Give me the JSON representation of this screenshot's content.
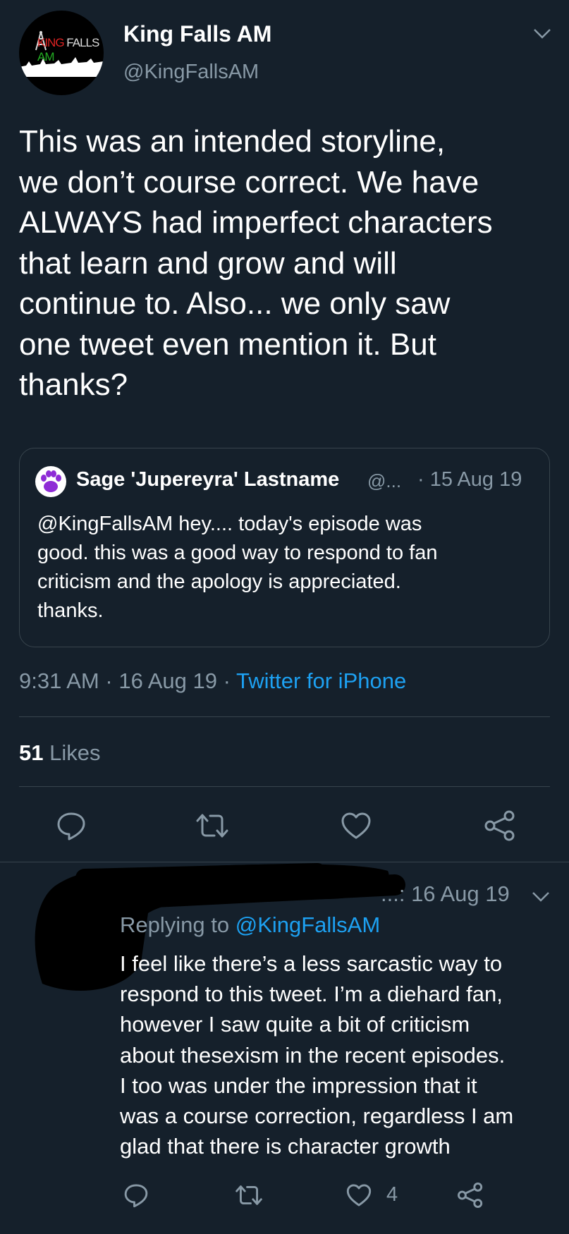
{
  "tweet": {
    "display_name": "King Falls AM",
    "handle": "@KingFallsAM",
    "avatar_logo_text": [
      "KING",
      "FALLS",
      "AM"
    ],
    "body": "This was an intended storyline,\nwe don’t course correct. We have\nALWAYS had imperfect characters\nthat learn and grow and will\ncontinue to. Also... we only saw\none tweet even mention it. But\nthanks?",
    "time": "9:31 AM",
    "date": "16 Aug 19",
    "source": "Twitter for iPhone",
    "likes_count": "51",
    "likes_label": "Likes"
  },
  "quote": {
    "display_name": "Sage 'Jupereyra' Lastname",
    "handle": "@...",
    "date": "· 15 Aug 19",
    "text": "@KingFallsAM hey.... today's episode was\ngood. this was a good way to respond to fan\ncriticism and the apology is appreciated.\nthanks."
  },
  "reply": {
    "date": "...: 16 Aug 19",
    "replying_prefix": "Replying to",
    "replying_handle": "@KingFallsAM",
    "text": "I feel like there’s a less sarcastic way to\nrespond to this tweet. I’m a diehard fan,\nhowever I saw quite a bit of criticism\nabout thesexism in the recent episodes.\nI too was under the impression that it\nwas a course correction, regardless I am\nglad that there is character growth",
    "like_count": "4"
  },
  "sep": "·",
  "colors": {
    "background": "#15202b",
    "muted": "#8899a6",
    "link": "#1da1f2",
    "divider": "#38444d",
    "quote_avatar_paw": "#8e2bd6"
  },
  "icons": [
    "chevron-down-icon",
    "reply-icon",
    "retweet-icon",
    "like-icon",
    "share-icon",
    "paw-icon"
  ]
}
